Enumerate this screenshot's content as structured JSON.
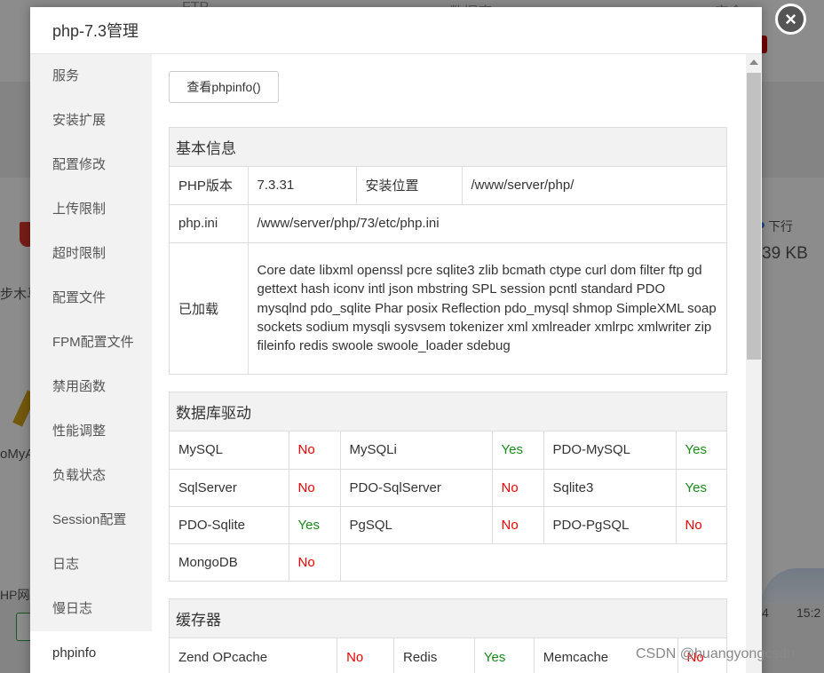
{
  "background": {
    "tabs": [
      "FTP",
      "数据库",
      "安全"
    ],
    "fragments": [
      "步木马",
      "oMyA",
      "HP网",
      "下行",
      "39 KB",
      "4",
      "15:2"
    ]
  },
  "dialog": {
    "title": "php-7.3管理",
    "close_glyph": "×"
  },
  "sidebar": {
    "items": [
      {
        "label": "服务"
      },
      {
        "label": "安装扩展"
      },
      {
        "label": "配置修改"
      },
      {
        "label": "上传限制"
      },
      {
        "label": "超时限制"
      },
      {
        "label": "配置文件"
      },
      {
        "label": "FPM配置文件"
      },
      {
        "label": "禁用函数"
      },
      {
        "label": "性能调整"
      },
      {
        "label": "负载状态"
      },
      {
        "label": "Session配置"
      },
      {
        "label": "日志"
      },
      {
        "label": "慢日志"
      },
      {
        "label": "phpinfo"
      }
    ],
    "active_index": 13
  },
  "main": {
    "phpinfo_button": "查看phpinfo()",
    "basic": {
      "title": "基本信息",
      "php_version_label": "PHP版本",
      "php_version": "7.3.31",
      "install_path_label": "安装位置",
      "install_path": "/www/server/php/",
      "ini_label": "php.ini",
      "ini_path": "/www/server/php/73/etc/php.ini",
      "loaded_label": "已加载",
      "loaded": "Core date libxml openssl pcre sqlite3 zlib bcmath ctype curl dom filter ftp gd gettext hash iconv intl json mbstring SPL session pcntl standard PDO mysqlnd pdo_sqlite Phar posix Reflection pdo_mysql shmop SimpleXML soap sockets sodium mysqli sysvsem tokenizer xml xmlreader xmlrpc xmlwriter zip fileinfo redis swoole swoole_loader sdebug"
    },
    "db": {
      "title": "数据库驱动",
      "rows": [
        [
          {
            "name": "MySQL",
            "status": "No"
          },
          {
            "name": "MySQLi",
            "status": "Yes"
          },
          {
            "name": "PDO-MySQL",
            "status": "Yes"
          }
        ],
        [
          {
            "name": "SqlServer",
            "status": "No"
          },
          {
            "name": "PDO-SqlServer",
            "status": "No"
          },
          {
            "name": "Sqlite3",
            "status": "Yes"
          }
        ],
        [
          {
            "name": "PDO-Sqlite",
            "status": "Yes"
          },
          {
            "name": "PgSQL",
            "status": "No"
          },
          {
            "name": "PDO-PgSQL",
            "status": "No"
          }
        ],
        [
          {
            "name": "MongoDB",
            "status": "No"
          }
        ]
      ]
    },
    "cache": {
      "title": "缓存器",
      "rows": [
        [
          {
            "name": "Zend OPcache",
            "status": "No"
          },
          {
            "name": "Redis",
            "status": "Yes"
          },
          {
            "name": "Memcache",
            "status": "No"
          }
        ]
      ]
    }
  },
  "watermark": "CSDN @huangyongcsdn",
  "colors": {
    "yes": "#1a8a1a",
    "no": "#e00000"
  }
}
